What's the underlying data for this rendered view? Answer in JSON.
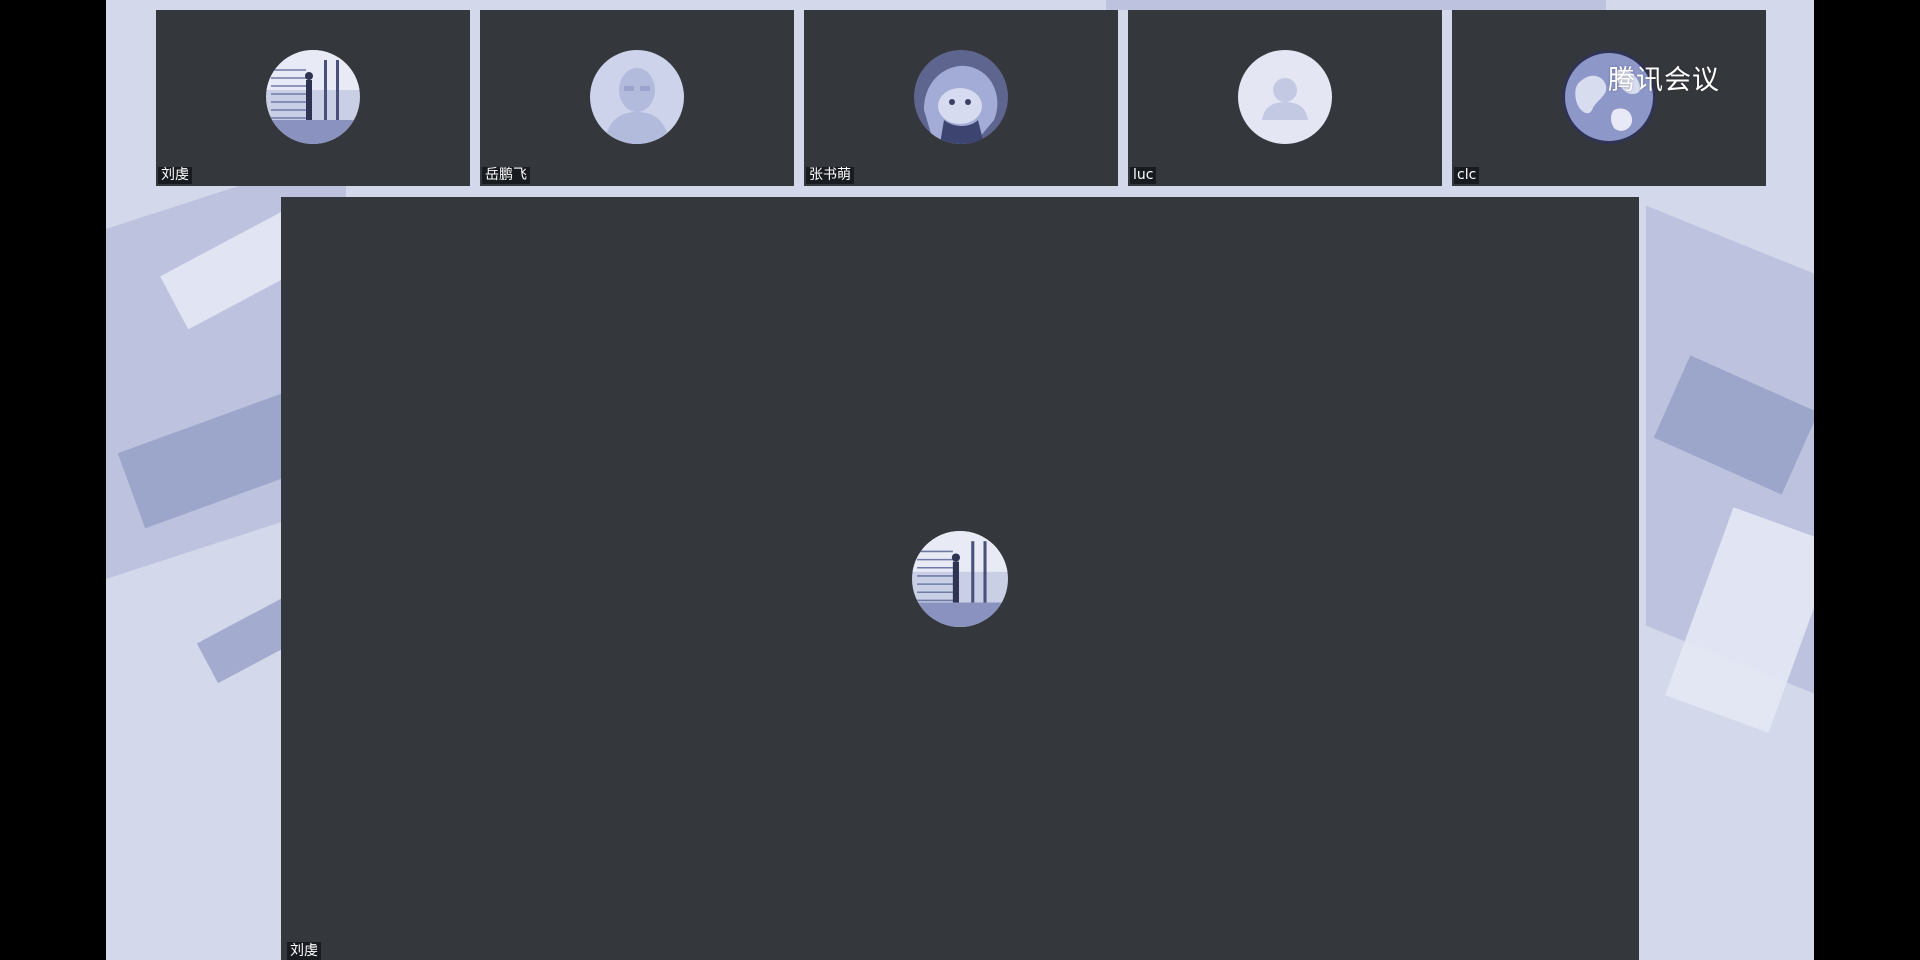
{
  "brand": {
    "name": "腾讯会议"
  },
  "participants": [
    {
      "name": "刘虔",
      "avatar_icon": "photo-avatar-icon"
    },
    {
      "name": "岳鹏飞",
      "avatar_icon": "default-face-avatar-icon"
    },
    {
      "name": "张书萌",
      "avatar_icon": "anime-avatar-icon"
    },
    {
      "name": "luc",
      "avatar_icon": "default-user-avatar-icon"
    },
    {
      "name": "clc",
      "avatar_icon": "earth-avatar-icon"
    }
  ],
  "active_speaker": {
    "name": "刘虔",
    "avatar_icon": "photo-avatar-icon"
  },
  "colors": {
    "tile_bg": "#34373c",
    "app_bg": "#d3d8ea",
    "avatar_tint": "#aab2d6"
  }
}
